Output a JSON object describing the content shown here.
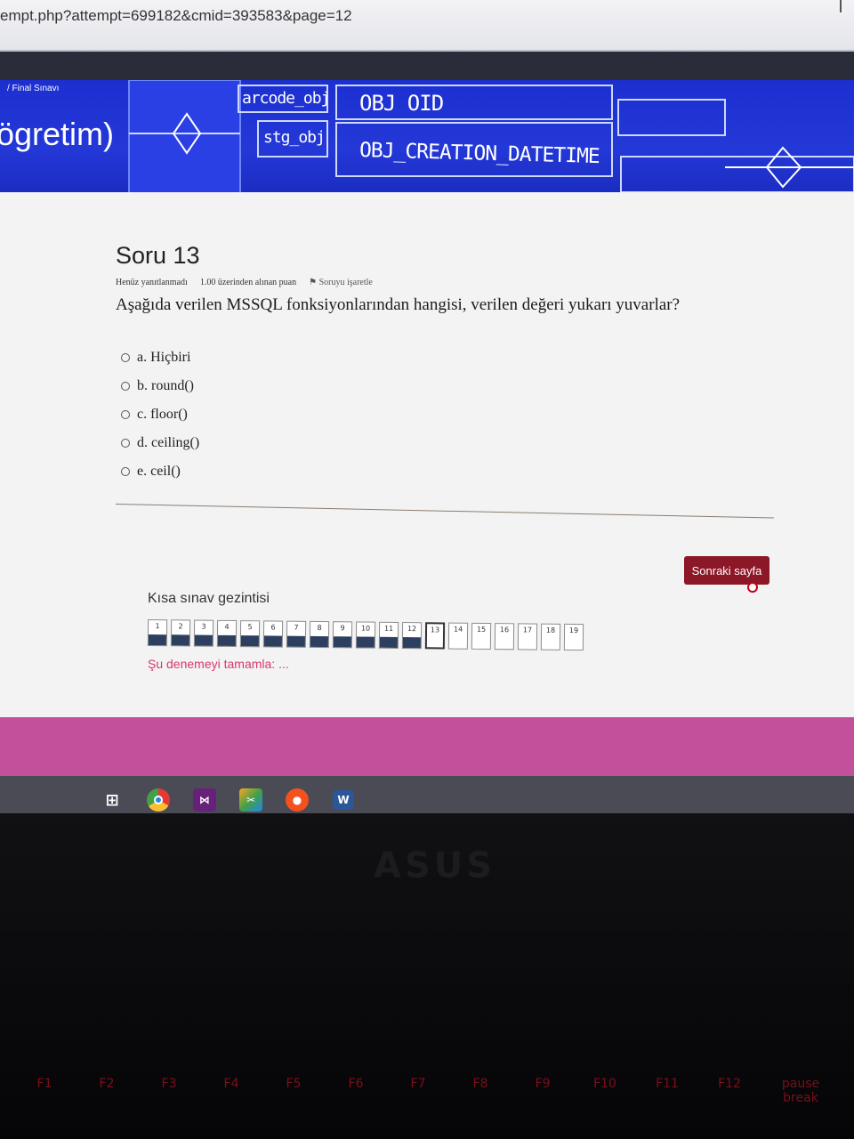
{
  "browser": {
    "url": "empt.php?attempt=699182&cmid=393583&page=12"
  },
  "banner": {
    "breadcrumb": "/ Final Sınavı",
    "title": "ögretim)",
    "diagram_texts": [
      "arcode_obj",
      "OBJ OID",
      "stg_obj",
      "OBJ_CREATION_DATETIME"
    ]
  },
  "question": {
    "title": "Soru 13",
    "status": "Henüz yanıtlanmadı",
    "points": "1.00 üzerinden alınan puan",
    "flag": "Soruyu işaretle",
    "text": "Aşağıda verilen MSSQL fonksiyonlarından hangisi, verilen değeri yukarı yuvarlar?",
    "answers": [
      "a. Hiçbiri",
      "b. round()",
      "c. floor()",
      "d. ceiling()",
      "e. ceil()"
    ]
  },
  "next_button": "Sonraki sayfa",
  "quiz_nav": {
    "title": "Kısa sınav gezintisi",
    "buttons": [
      "1",
      "2",
      "3",
      "4",
      "5",
      "6",
      "7",
      "8",
      "9",
      "10",
      "11",
      "12",
      "13",
      "14",
      "15",
      "16",
      "17",
      "18",
      "19"
    ],
    "answered_count": 12,
    "current": "13",
    "finish": "Şu denemeyi tamamla: ..."
  },
  "taskbar": {
    "icons": [
      "task-view-icon",
      "chrome-icon",
      "visual-studio-icon",
      "snipping-tool-icon",
      "app-orange-icon",
      "word-icon"
    ],
    "word_label": "W"
  },
  "keyboard": {
    "keys": [
      "F1",
      "F2",
      "F3",
      "F4",
      "F5",
      "F6",
      "F7",
      "F8",
      "F9",
      "F10",
      "F11",
      "F12",
      "pause break"
    ]
  },
  "colors": {
    "banner": "#2438d8",
    "next_button": "#8c1726",
    "pink_bar": "#c2509a",
    "finish_link": "#d63a6a"
  }
}
